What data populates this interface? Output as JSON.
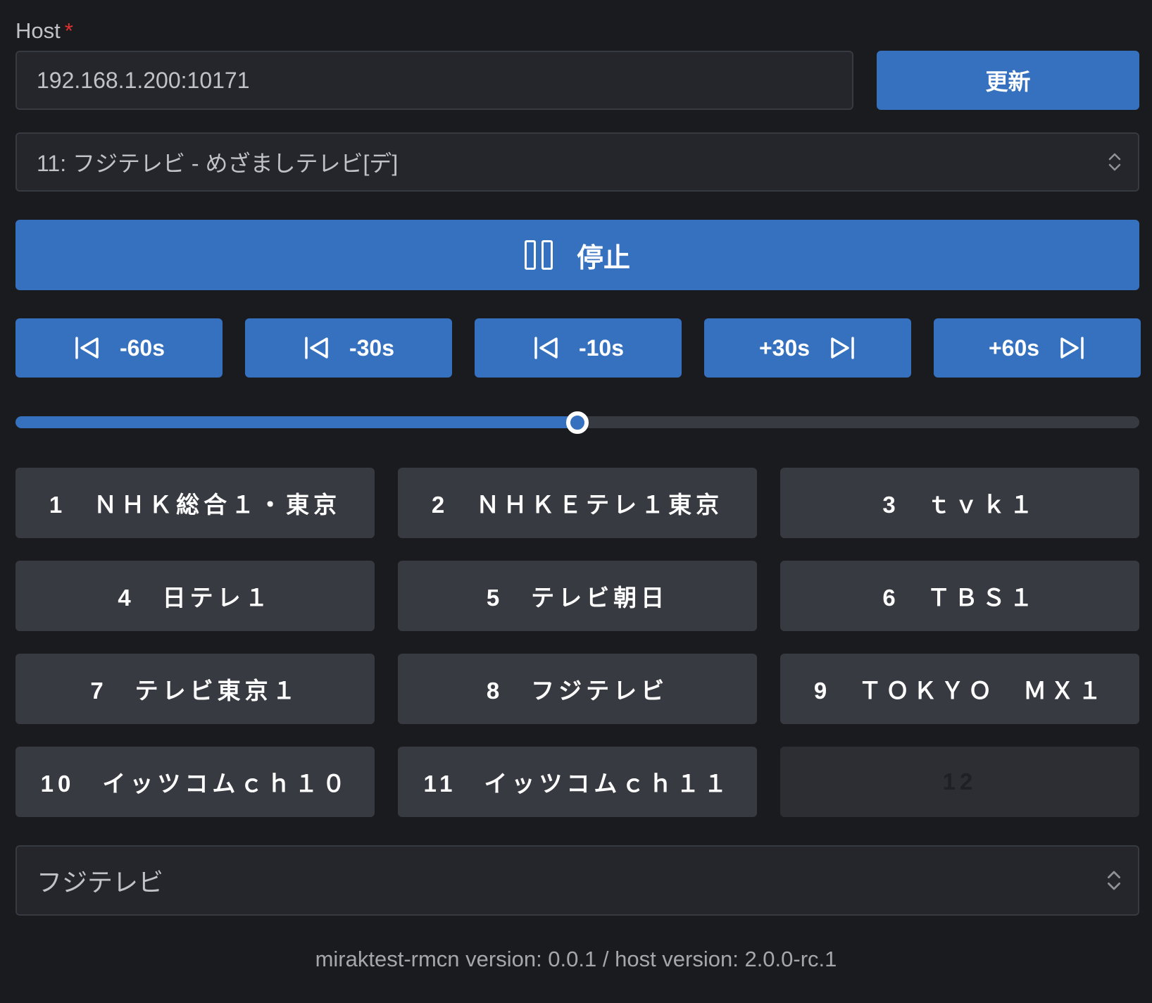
{
  "host": {
    "label": "Host",
    "required_mark": "*",
    "value": "192.168.1.200:10171",
    "update_label": "更新"
  },
  "program_select": {
    "selected": "11: フジテレビ - めざましテレビ[デ]"
  },
  "playback": {
    "stop_label": "停止",
    "seek_buttons": [
      "-60s",
      "-30s",
      "-10s",
      "+30s",
      "+60s"
    ],
    "progress_fraction": 0.5
  },
  "channels": [
    "1　ＮＨＫ総合１・東京",
    "2　ＮＨＫＥテレ１東京",
    "3　ｔｖｋ１",
    "4　日テレ１",
    "5　テレビ朝日",
    "6　ＴＢＳ１",
    "7　テレビ東京１",
    "8　フジテレビ",
    "9　ＴＯＫＹＯ　ＭＸ１",
    "10　イッツコムｃｈ１０",
    "11　イッツコムｃｈ１１",
    "12"
  ],
  "station_select": {
    "selected": "フジテレビ"
  },
  "footer": {
    "text": "miraktest-rmcn version: 0.0.1 / host version: 2.0.0-rc.1"
  },
  "colors": {
    "background": "#1a1b1e",
    "accent": "#3571bf",
    "button_gray": "#373a40",
    "required": "#e03131"
  },
  "icons": {
    "stop": "pause-icon",
    "rewind": "skip-back-icon",
    "forward": "skip-forward-icon",
    "select": "chevron-up-down-icon"
  }
}
